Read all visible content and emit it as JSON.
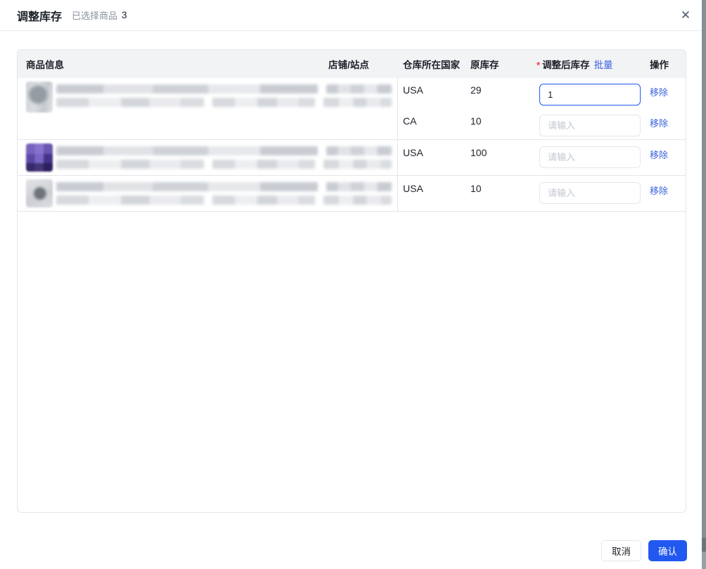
{
  "modal": {
    "title": "调整库存",
    "selected_label": "已选择商品",
    "selected_count": "3",
    "close_glyph": "✕"
  },
  "table": {
    "headers": {
      "product": "商品信息",
      "store": "店铺/站点",
      "warehouse_country": "仓库所在国家",
      "original_stock": "原库存",
      "required_mark": "*",
      "adjusted_stock": "调整后库存",
      "batch": "批量",
      "action": "操作"
    },
    "ui": {
      "input_placeholder": "请输入",
      "remove_label": "移除"
    },
    "groups": [
      {
        "product_redacted": true,
        "rows": [
          {
            "country": "USA",
            "original_stock": "29",
            "adjusted_value": "1",
            "focused": true
          },
          {
            "country": "CA",
            "original_stock": "10",
            "adjusted_value": ""
          }
        ]
      },
      {
        "product_redacted": true,
        "rows": [
          {
            "country": "USA",
            "original_stock": "100",
            "adjusted_value": ""
          }
        ]
      },
      {
        "product_redacted": true,
        "rows": [
          {
            "country": "USA",
            "original_stock": "10",
            "adjusted_value": ""
          }
        ]
      }
    ]
  },
  "footer": {
    "cancel": "取消",
    "confirm": "确认"
  },
  "colors": {
    "primary_blue": "#2158f0",
    "link_blue": "#3a63dd",
    "danger_red": "#f23c3c",
    "text_primary": "#1d2129",
    "text_secondary": "#8a919f",
    "placeholder": "#c2c7cf",
    "border": "#e5e6eb",
    "table_header_bg": "#f2f3f5",
    "scrollbar_gray": "#878e96"
  }
}
